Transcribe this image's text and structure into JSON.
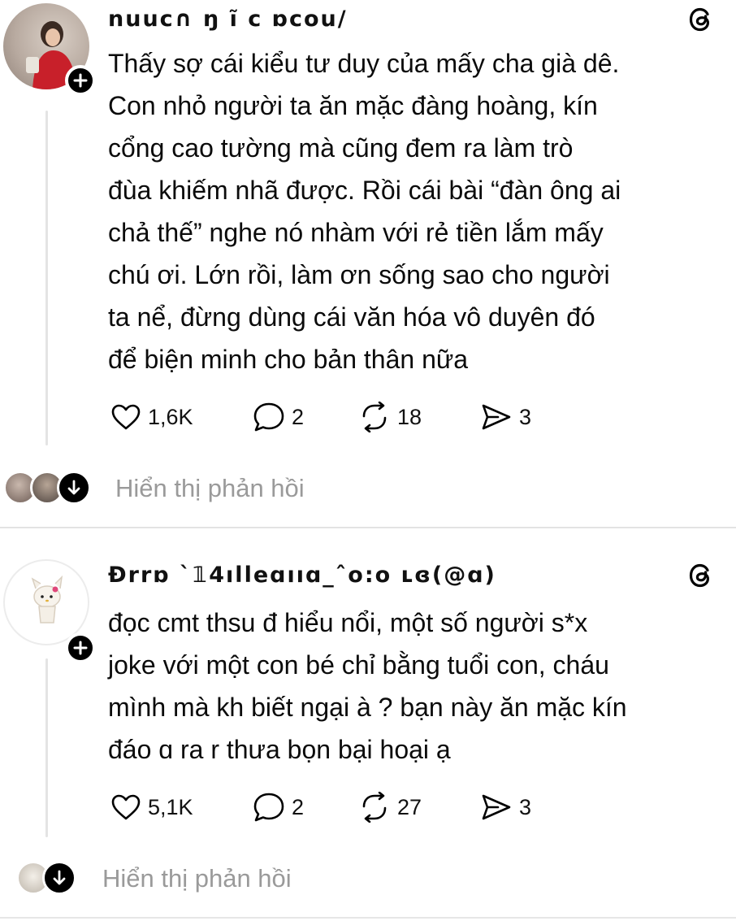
{
  "posts": [
    {
      "username": "nuuc∩ ŋ ĩ c ɒcou/",
      "text": "Thấy sợ cái kiểu tư duy của mấy cha già dê.\nCon nhỏ người ta ăn mặc đàng hoàng, kín\ncổng cao tường mà cũng đem ra làm trò\nđùa khiếm nhã được. Rồi cái bài “đàn ông ai\nchả thế” nghe nó nhàm với rẻ tiền lắm mấy\nchú ơi. Lớn rồi, làm ơn sống sao cho người\nta nể, đừng dùng cái văn hóa vô duyên đó\nđể biện minh cho bản thân nữa",
      "likes": "1,6K",
      "comments": "2",
      "reposts": "18",
      "shares": "3",
      "show_replies": "Hiển thị phản hồi"
    },
    {
      "username": "Ðrrɒ ˋ𝟙4ılleɑııɑ_ˆo:o ʟɞ(@ɑ)",
      "text": "đọc cmt thsu đ hiểu nổi, một số người s*x\njoke với một con bé chỉ bằng tuổi con, cháu\nmình mà kh biết ngại à ? bạn này ăn mặc kín\nđáo  ɑ ra r thưa bọn bại hoại ạ",
      "likes": "5,1K",
      "comments": "2",
      "reposts": "27",
      "shares": "3",
      "show_replies": "Hiển thị phản hồi"
    }
  ],
  "icons": {
    "like": "heart-icon",
    "comment": "comment-bubble-icon",
    "repost": "repost-icon",
    "share": "send-icon",
    "app": "threads-logo-icon",
    "follow": "plus-icon",
    "expand": "arrow-down-icon"
  },
  "colors": {
    "text": "#0b0b0b",
    "muted": "#9a9a9a",
    "divider": "#e3e3e3",
    "badge": "#000000"
  }
}
